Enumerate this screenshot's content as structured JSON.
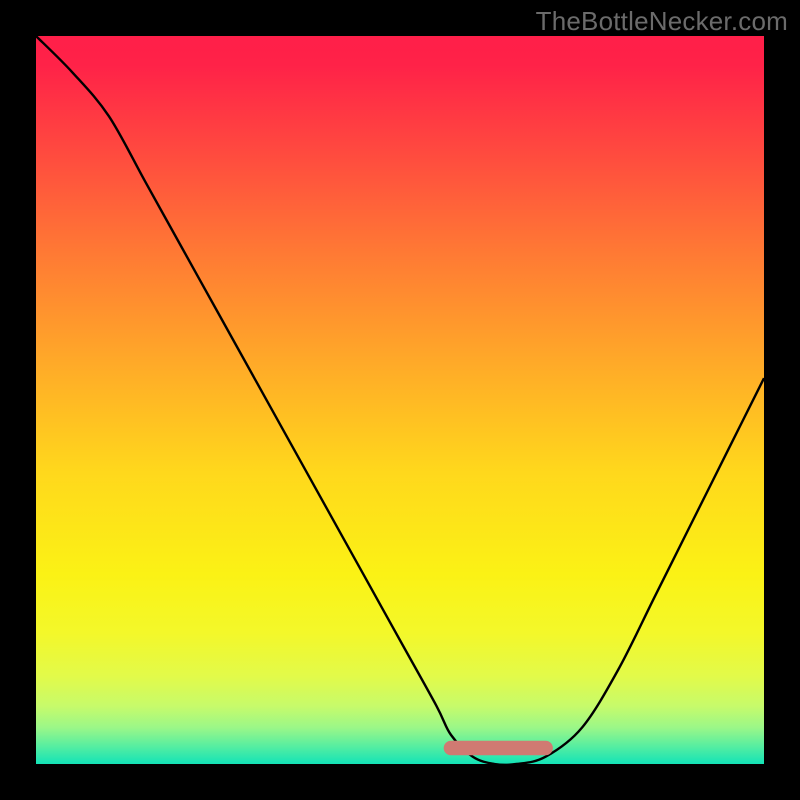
{
  "watermark": "TheBottleNecker.com",
  "chart_data": {
    "type": "line",
    "title": "",
    "xlabel": "",
    "ylabel": "",
    "xlim": [
      0,
      100
    ],
    "ylim": [
      0,
      100
    ],
    "series": [
      {
        "name": "curve",
        "x": [
          0,
          5,
          10,
          15,
          20,
          25,
          30,
          35,
          40,
          45,
          50,
          55,
          57,
          60,
          63,
          66,
          70,
          75,
          80,
          85,
          90,
          95,
          100
        ],
        "values": [
          100,
          95,
          89,
          80,
          71,
          62,
          53,
          44,
          35,
          26,
          17,
          8,
          4,
          1,
          0,
          0,
          1,
          5,
          13,
          23,
          33,
          43,
          53
        ]
      }
    ],
    "background_gradient_stops": [
      {
        "offset": 0.0,
        "color": "#ff1f49"
      },
      {
        "offset": 0.04,
        "color": "#ff2248"
      },
      {
        "offset": 0.16,
        "color": "#ff4a3f"
      },
      {
        "offset": 0.3,
        "color": "#ff7a34"
      },
      {
        "offset": 0.45,
        "color": "#ffaa28"
      },
      {
        "offset": 0.6,
        "color": "#ffd81c"
      },
      {
        "offset": 0.74,
        "color": "#fbf215"
      },
      {
        "offset": 0.82,
        "color": "#f3f82a"
      },
      {
        "offset": 0.88,
        "color": "#e2fa4a"
      },
      {
        "offset": 0.92,
        "color": "#c7fb6a"
      },
      {
        "offset": 0.95,
        "color": "#9bf788"
      },
      {
        "offset": 0.975,
        "color": "#58eea0"
      },
      {
        "offset": 1.0,
        "color": "#13e3b7"
      }
    ],
    "minimum_band": {
      "x_start": 57,
      "x_end": 70,
      "y": 2.2,
      "color": "#d07a72",
      "thickness": 2.0
    },
    "curve_color": "#000000",
    "curve_width": 2.4
  }
}
